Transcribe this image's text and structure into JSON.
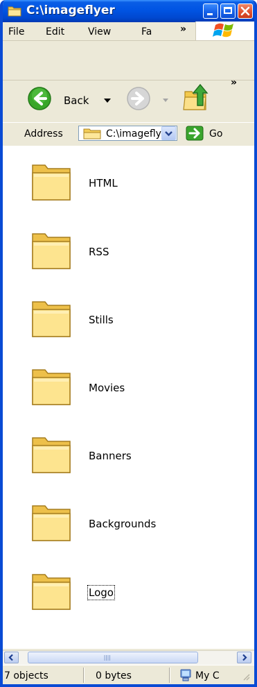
{
  "window": {
    "title": "C:\\imageflyer"
  },
  "menubar": {
    "items": [
      "File",
      "Edit",
      "View",
      "Fa"
    ],
    "overflow": "»"
  },
  "toolbar": {
    "back_label": "Back",
    "overflow": "»"
  },
  "address": {
    "label": "Address",
    "value": "C:\\imageflyer",
    "go_label": "Go"
  },
  "folders": [
    {
      "name": "HTML"
    },
    {
      "name": "RSS"
    },
    {
      "name": "Stills"
    },
    {
      "name": "Movies"
    },
    {
      "name": "Banners"
    },
    {
      "name": "Backgrounds"
    },
    {
      "name": "Logo"
    }
  ],
  "statusbar": {
    "objects": "7 objects",
    "size": "0 bytes",
    "zone": "My C"
  },
  "colors": {
    "titlebar": "#0054e3",
    "folder": "#f6d66a",
    "close": "#e0512f"
  }
}
